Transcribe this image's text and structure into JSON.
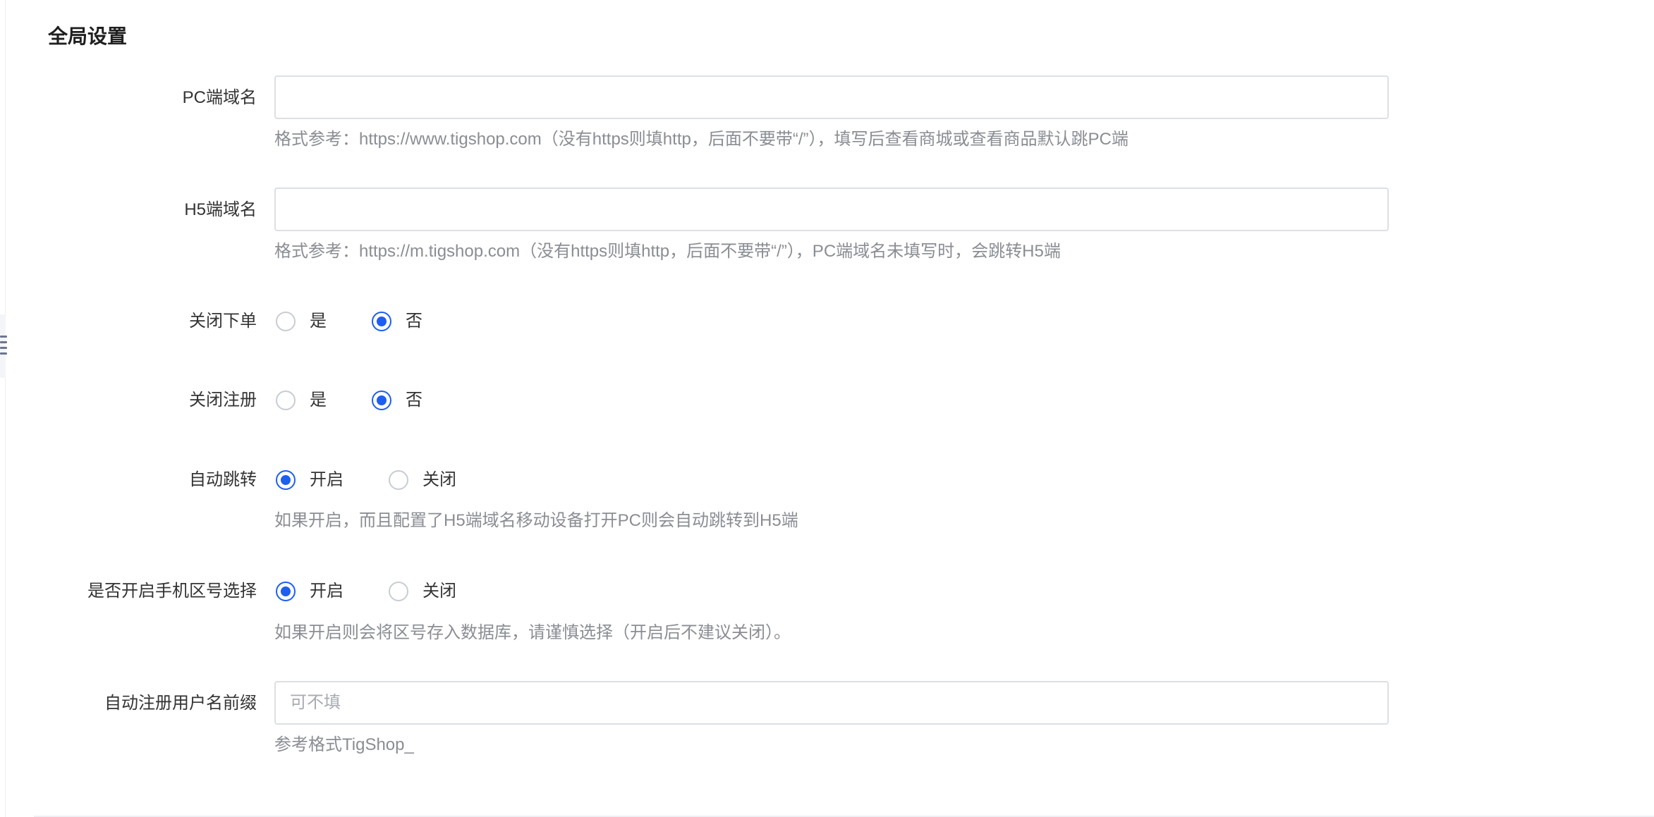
{
  "section": {
    "title": "全局设置"
  },
  "fields": {
    "pc_domain": {
      "label": "PC端域名",
      "value": "",
      "placeholder": "",
      "hint": "格式参考：https://www.tigshop.com（没有https则填http，后面不要带“/”），填写后查看商城或查看商品默认跳PC端"
    },
    "h5_domain": {
      "label": "H5端域名",
      "value": "",
      "placeholder": "",
      "hint": "格式参考：https://m.tigshop.com（没有https则填http，后面不要带“/”），PC端域名未填写时，会跳转H5端"
    },
    "close_order": {
      "label": "关闭下单",
      "options": [
        "是",
        "否"
      ],
      "selected": "否"
    },
    "close_register": {
      "label": "关闭注册",
      "options": [
        "是",
        "否"
      ],
      "selected": "否"
    },
    "auto_redirect": {
      "label": "自动跳转",
      "options": [
        "开启",
        "关闭"
      ],
      "selected": "开启",
      "hint": "如果开启，而且配置了H5端域名移动设备打开PC则会自动跳转到H5端"
    },
    "phone_area_code": {
      "label": "是否开启手机区号选择",
      "options": [
        "开启",
        "关闭"
      ],
      "selected": "开启",
      "hint": "如果开启则会将区号存入数据库，请谨慎选择（开启后不建议关闭）。"
    },
    "username_prefix": {
      "label": "自动注册用户名前缀",
      "value": "",
      "placeholder": "可不填",
      "hint": "参考格式TigShop_"
    }
  },
  "colors": {
    "accent": "#1e5ef0",
    "label_text": "#333333",
    "hint_text": "#8a8d93",
    "input_border": "#dcdfe6"
  },
  "icons": {
    "sidebar_toggle": "menu-collapse-icon"
  }
}
